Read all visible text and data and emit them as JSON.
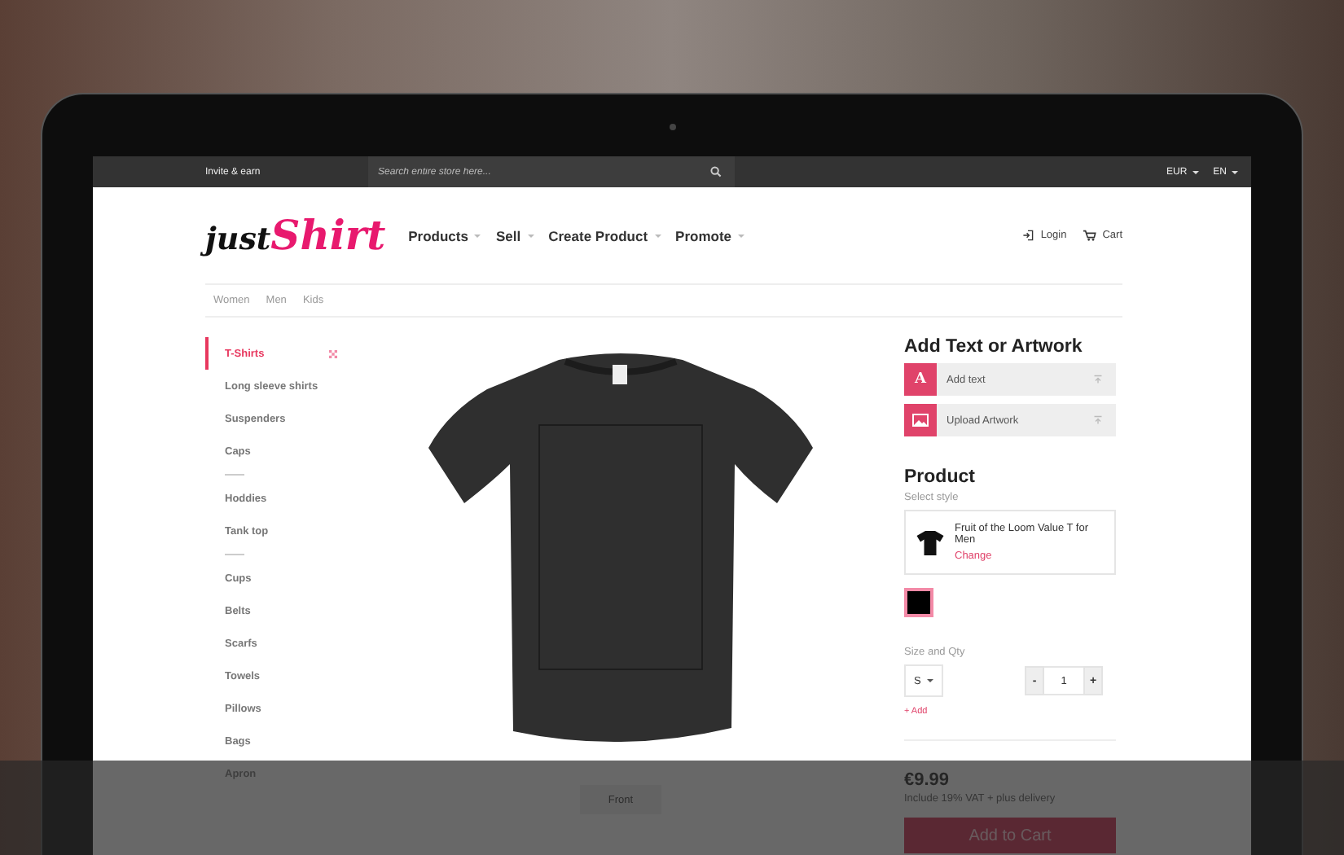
{
  "top_bar": {
    "invite_link": "Invite & earn",
    "search": {
      "placeholder": "Search entire store here..."
    },
    "currency": "EUR",
    "language": "EN"
  },
  "header": {
    "logo": {
      "first": "just",
      "second": "Shirt"
    },
    "nav": [
      {
        "label": "Products"
      },
      {
        "label": "Sell"
      },
      {
        "label": "Create Product"
      },
      {
        "label": "Promote"
      }
    ],
    "login": "Login",
    "cart": "Cart"
  },
  "sub_nav": [
    {
      "label": "Women"
    },
    {
      "label": "Men"
    },
    {
      "label": "Kids"
    }
  ],
  "sidebar": {
    "items": [
      {
        "kind": "link",
        "label": "T-Shirts",
        "selected": true
      },
      {
        "kind": "link",
        "label": "Long sleeve shirts",
        "selected": false
      },
      {
        "kind": "link",
        "label": "Suspenders",
        "selected": false
      },
      {
        "kind": "link",
        "label": "Caps",
        "selected": false
      },
      {
        "kind": "divider"
      },
      {
        "kind": "link",
        "label": "Hoddies",
        "selected": false
      },
      {
        "kind": "link",
        "label": "Tank top",
        "selected": false
      },
      {
        "kind": "divider"
      },
      {
        "kind": "link",
        "label": "Cups",
        "selected": false
      },
      {
        "kind": "link",
        "label": "Belts",
        "selected": false
      },
      {
        "kind": "link",
        "label": "Scarfs",
        "selected": false
      },
      {
        "kind": "link",
        "label": "Towels",
        "selected": false
      },
      {
        "kind": "link",
        "label": "Pillows",
        "selected": false
      },
      {
        "kind": "link",
        "label": "Bags",
        "selected": false
      },
      {
        "kind": "link",
        "label": "Apron",
        "selected": false
      }
    ]
  },
  "preview": {
    "view_button": "Front"
  },
  "panel": {
    "artwork_title": "Add Text or Artwork",
    "tools": [
      {
        "kind": "text",
        "icon_letter": "A",
        "label": "Add text"
      },
      {
        "kind": "image",
        "label": "Upload Artwork"
      }
    ],
    "product_title": "Product",
    "select_style_label": "Select style",
    "style": {
      "name": "Fruit of the Loom Value T for Men",
      "change": "Change"
    },
    "swatches": [
      {
        "color": "#000000",
        "selected": true
      }
    ],
    "size_qty_label": "Size and Qty",
    "size": "S",
    "minus": "-",
    "qty": "1",
    "plus": "+",
    "add_link": "+ Add",
    "price": "€9.99",
    "vat_note": "Include 19% VAT + plus delivery",
    "add_to_cart": "Add to Cart"
  }
}
